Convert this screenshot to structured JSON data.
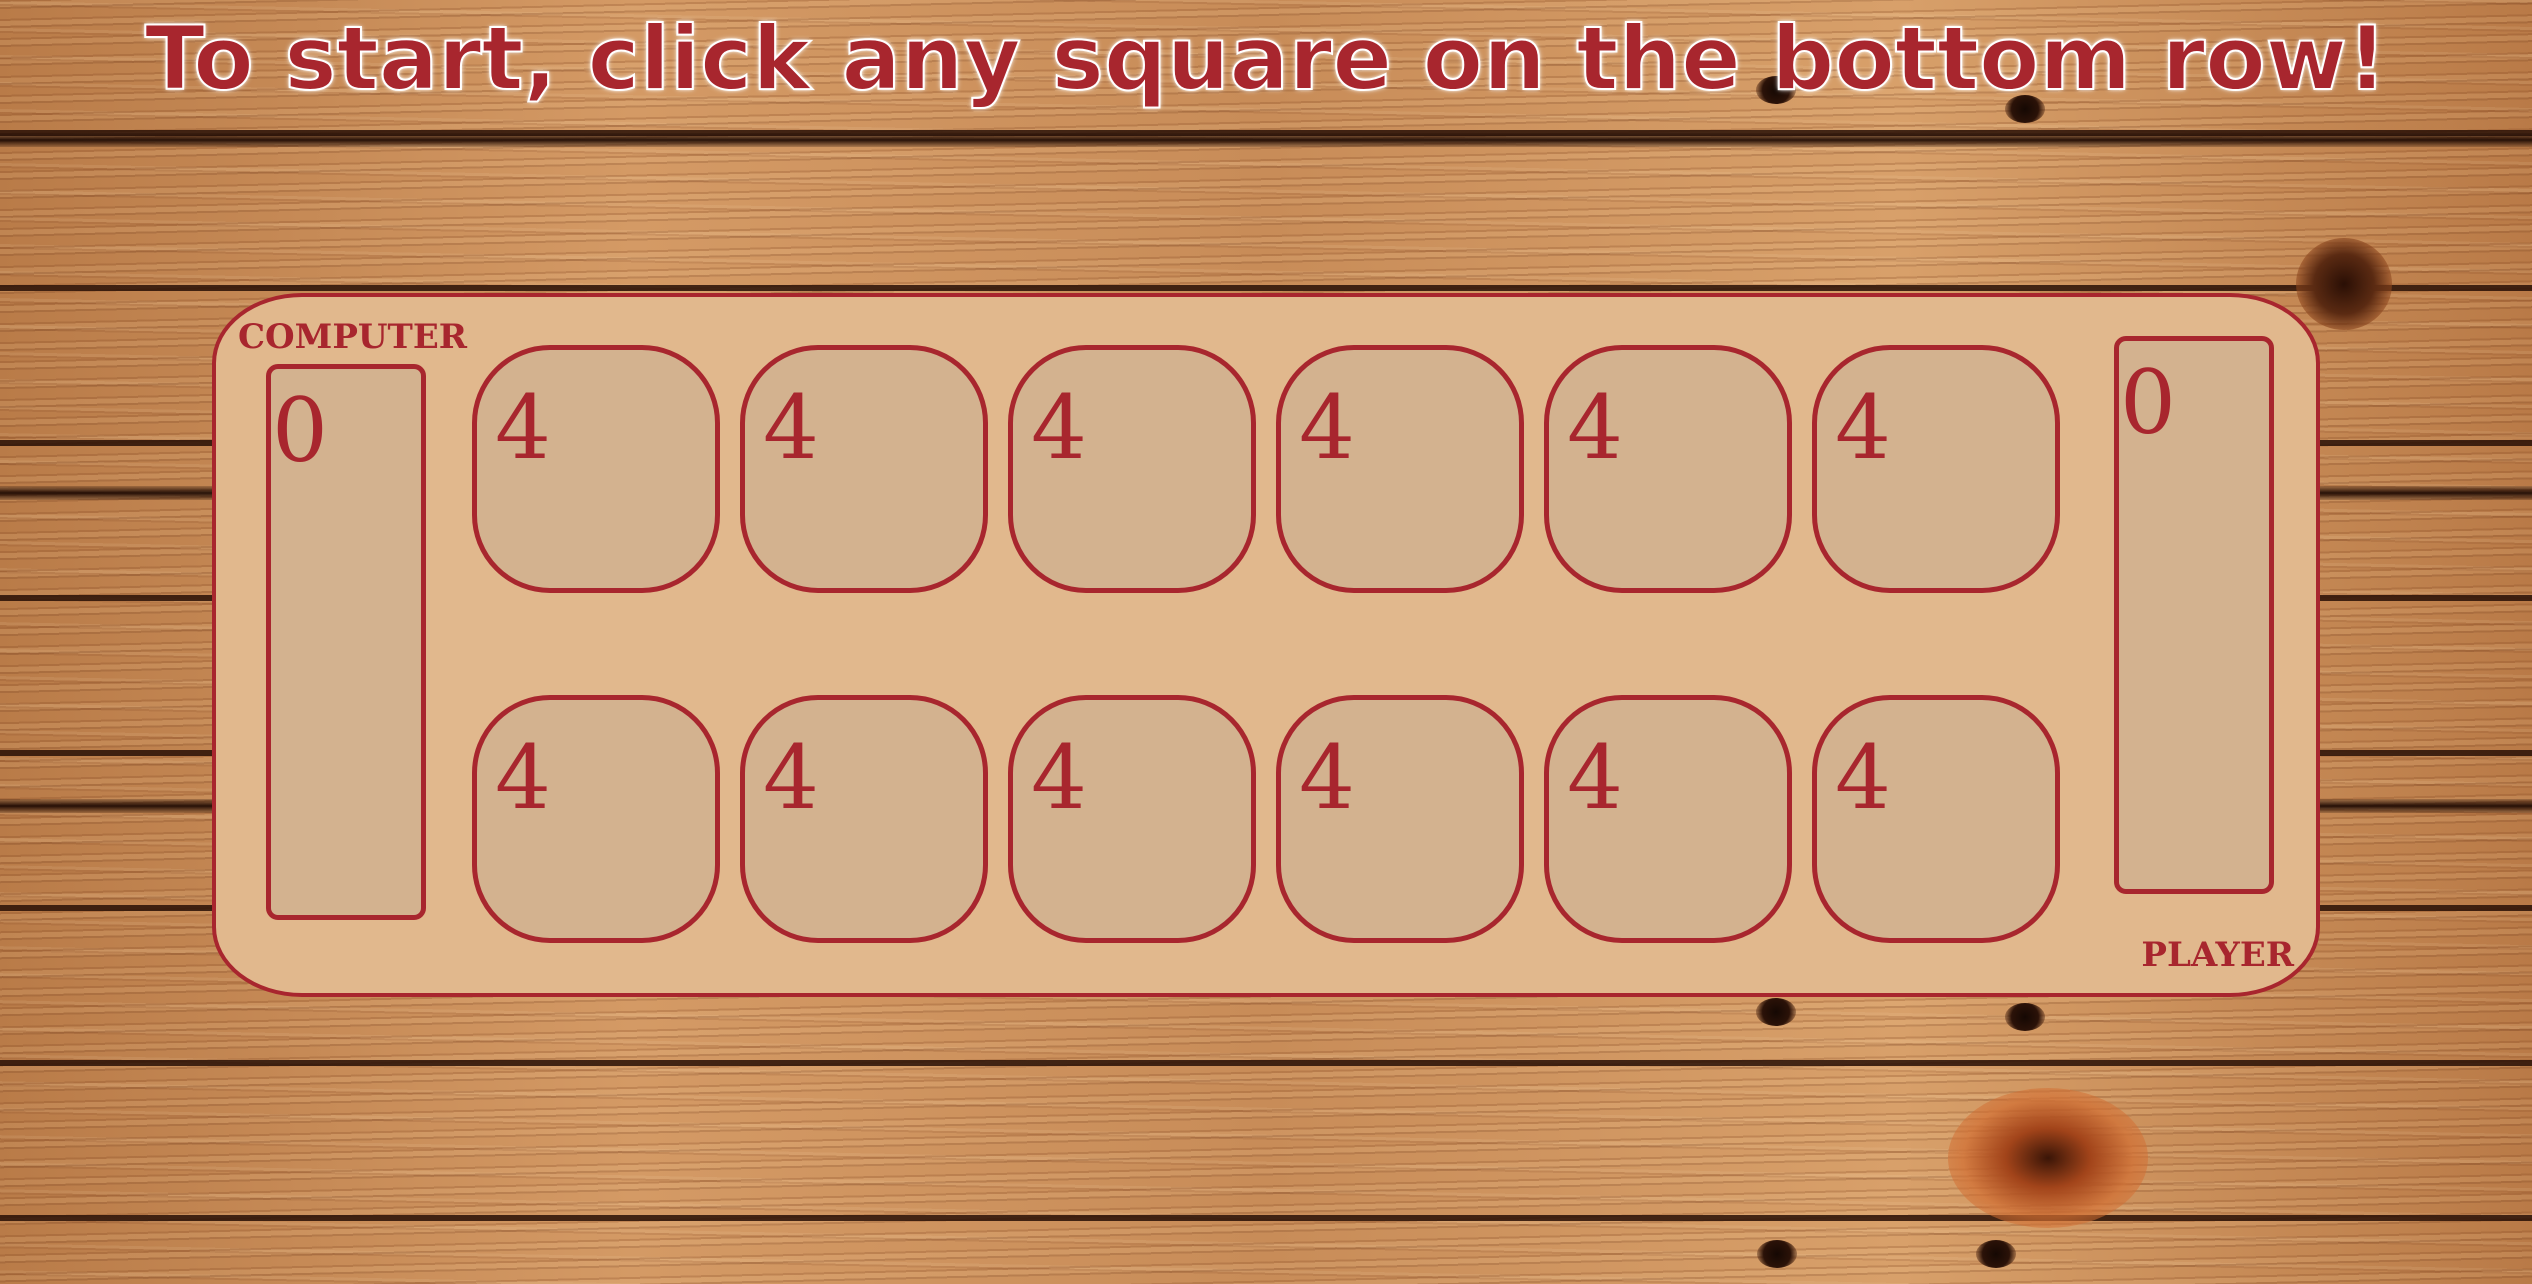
{
  "instruction": "To start, click any square on the bottom row!",
  "board": {
    "computer_label": "COMPUTER",
    "player_label": "PLAYER",
    "computer_store": "0",
    "player_store": "0",
    "computer_pits": [
      "4",
      "4",
      "4",
      "4",
      "4",
      "4"
    ],
    "player_pits": [
      "4",
      "4",
      "4",
      "4",
      "4",
      "4"
    ]
  },
  "colors": {
    "accent": "#a8262e",
    "board": "#e1b88d",
    "pit": "#d3b28f",
    "outline_text": "#ffffff"
  }
}
